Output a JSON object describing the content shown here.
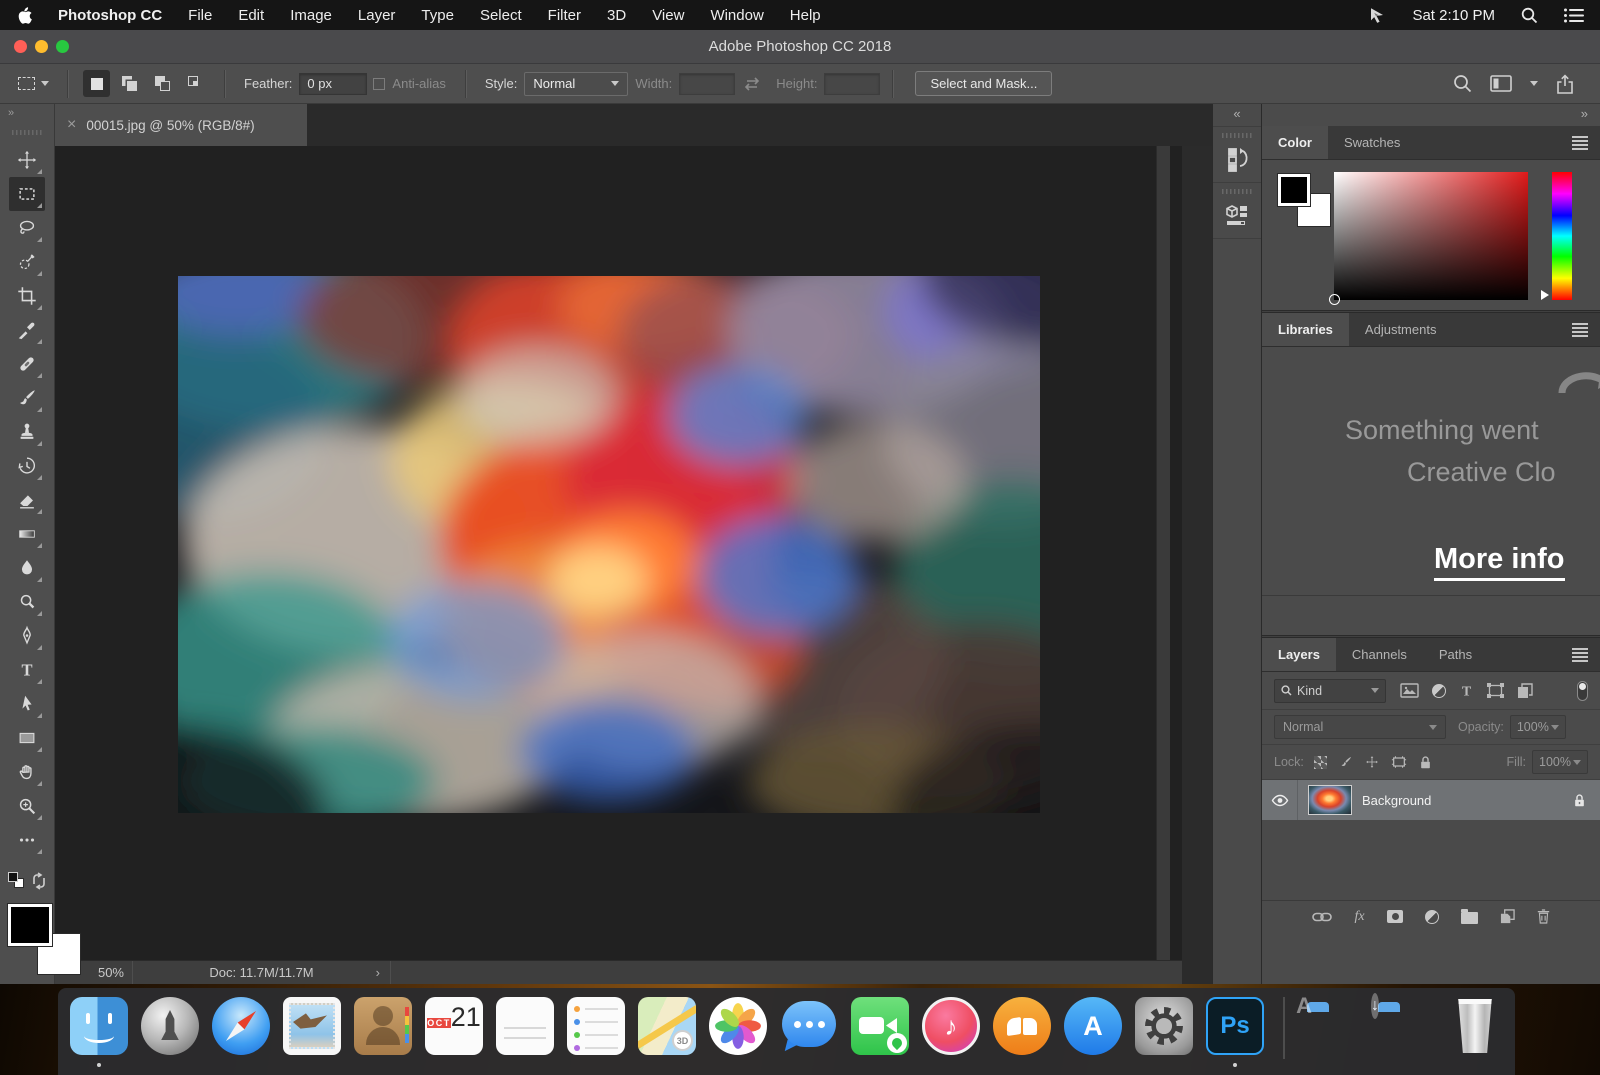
{
  "menubar": {
    "app_name": "Photoshop CC",
    "items": [
      "File",
      "Edit",
      "Image",
      "Layer",
      "Type",
      "Select",
      "Filter",
      "3D",
      "View",
      "Window",
      "Help"
    ],
    "time": "Sat 2:10 PM"
  },
  "titlebar": {
    "title": "Adobe Photoshop CC 2018"
  },
  "options": {
    "feather_label": "Feather:",
    "feather_value": "0 px",
    "antialias_label": "Anti-alias",
    "style_label": "Style:",
    "style_value": "Normal",
    "width_label": "Width:",
    "height_label": "Height:",
    "select_mask_label": "Select and Mask..."
  },
  "document": {
    "tab_title": "00015.jpg @ 50% (RGB/8#)",
    "close_glyph": "×"
  },
  "toolbar": {
    "expand_glyph": "»",
    "tools": [
      "move",
      "rectangular-marquee",
      "lasso",
      "quick-selection",
      "crop",
      "eyedropper",
      "spot-healing-brush",
      "brush",
      "clone-stamp",
      "history-brush",
      "eraser",
      "gradient",
      "blur",
      "dodge",
      "pen",
      "type",
      "path-selection",
      "rectangle-shape",
      "hand",
      "zoom",
      "edit-toolbar"
    ]
  },
  "statusbar": {
    "zoom_level": "50%",
    "doc_sizes": "Doc: 11.7M/11.7M",
    "chevron": "›"
  },
  "panels": {
    "collapse_glyph": "«",
    "expand_glyph": "»",
    "color": {
      "tab_color": "Color",
      "tab_swatches": "Swatches"
    },
    "libraries": {
      "tab_libraries": "Libraries",
      "tab_adjustments": "Adjustments",
      "message_line1": "Something went",
      "message_line2": "Creative Clo",
      "more_info_link": "More info"
    },
    "layers": {
      "tab_layers": "Layers",
      "tab_channels": "Channels",
      "tab_paths": "Paths",
      "kind_label": "Kind",
      "blend_mode": "Normal",
      "opacity_label": "Opacity:",
      "opacity_value": "100%",
      "lock_label": "Lock:",
      "fill_label": "Fill:",
      "fill_value": "100%",
      "fx_label": "fx",
      "layer_name": "Background"
    }
  },
  "dock": {
    "calendar_month": "OCT",
    "calendar_day": "21",
    "maps_badge": "3D",
    "appstore_letter": "A",
    "apps_folder_letter": "A",
    "downloads_arrow": "↓",
    "itunes_note": "♪",
    "ps_label": "Ps",
    "items": [
      "finder",
      "launchpad",
      "safari",
      "mail",
      "contacts",
      "calendar",
      "notes",
      "reminders",
      "maps",
      "photos",
      "messages",
      "facetime",
      "itunes",
      "ibooks",
      "app-store",
      "system-preferences",
      "photoshop",
      "applications-folder",
      "downloads-folder",
      "trash"
    ]
  },
  "colors": {
    "ps_accent": "#2fa3f7",
    "calendar_red": "#e8483f",
    "titlebar_gray": "#4a4a4c"
  }
}
